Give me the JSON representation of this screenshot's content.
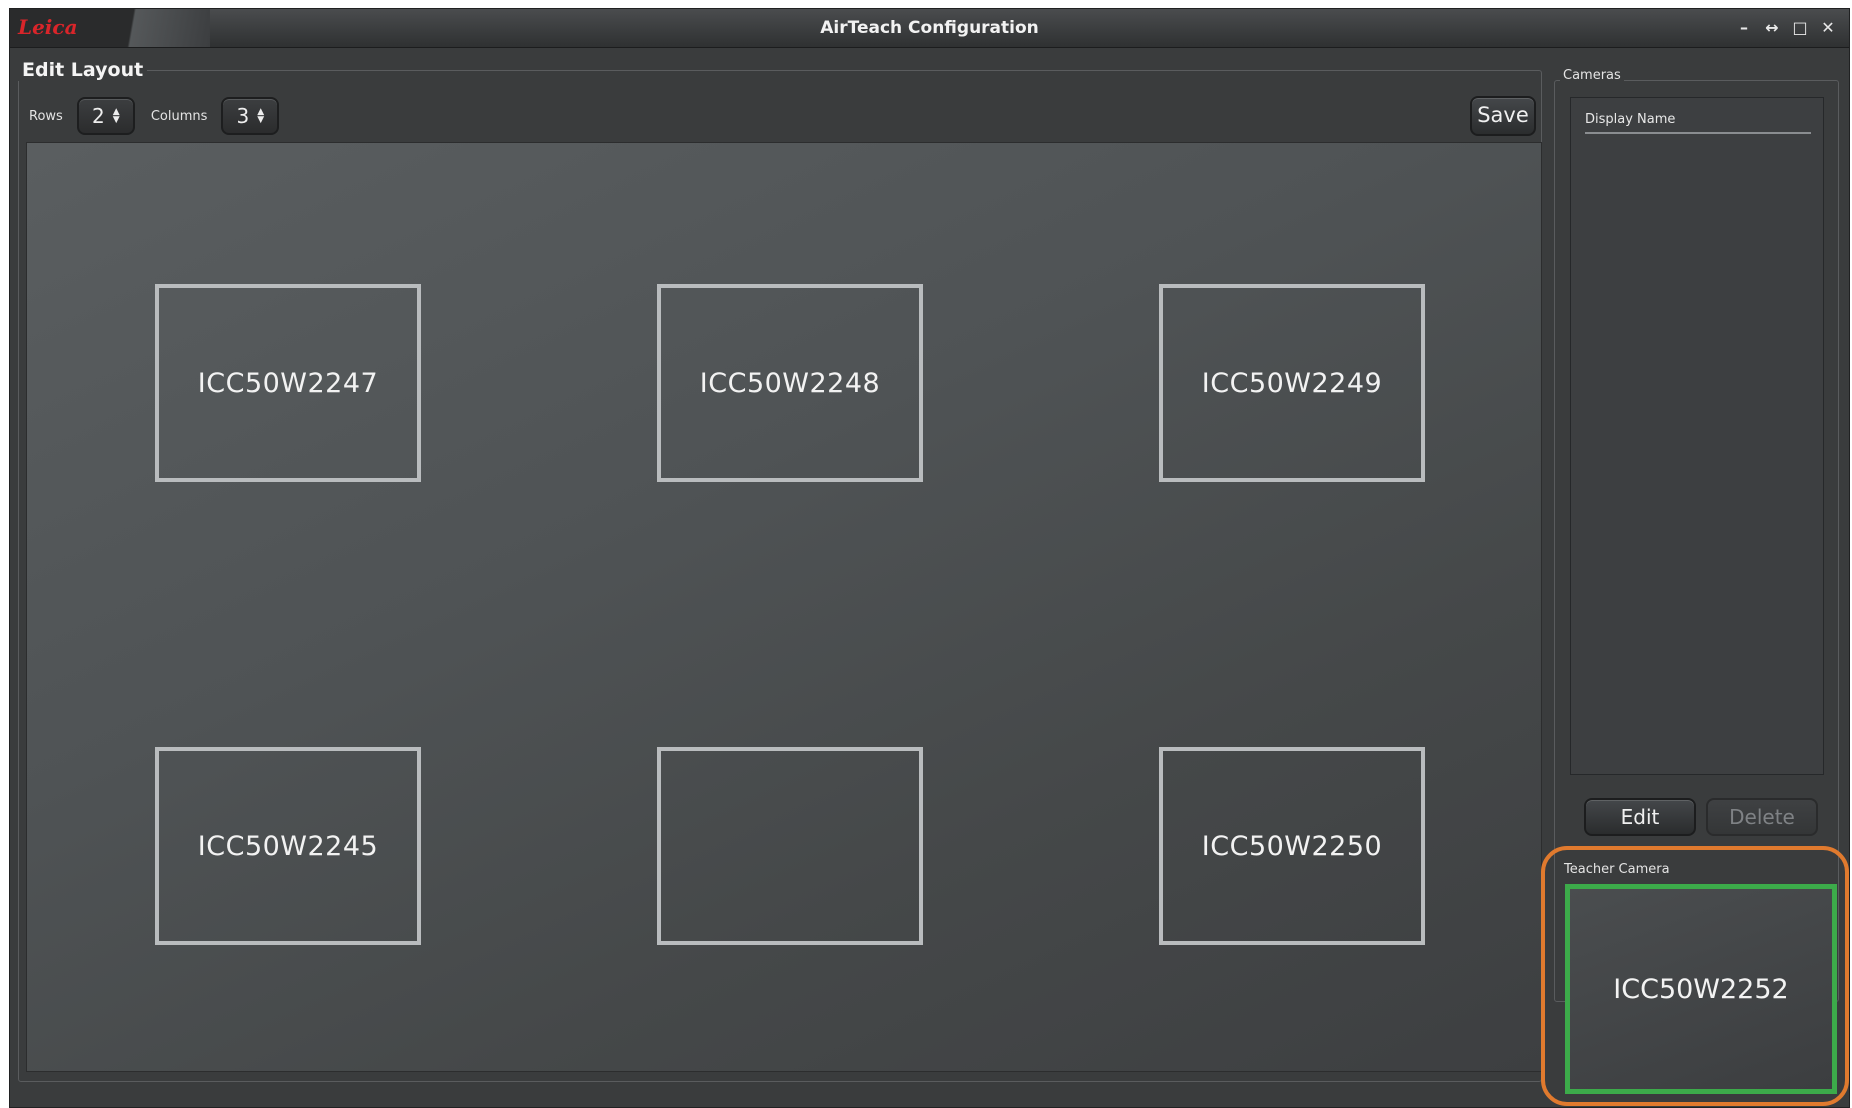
{
  "window": {
    "title": "AirTeach Configuration",
    "logo_text": "Leica",
    "controls": [
      "–",
      "↔",
      "□",
      "✕"
    ]
  },
  "edit_layout": {
    "label": "Edit Layout",
    "rows_label": "Rows",
    "rows_value": "2",
    "columns_label": "Columns",
    "columns_value": "3",
    "save_label": "Save",
    "tiles": [
      "ICC50W2247",
      "ICC50W2248",
      "ICC50W2249",
      "ICC50W2245",
      "",
      "ICC50W2250"
    ]
  },
  "cameras": {
    "label": "Cameras",
    "column_header": "Display Name",
    "edit_label": "Edit",
    "delete_label": "Delete"
  },
  "teacher_camera": {
    "label": "Teacher Camera",
    "name": "ICC50W2252"
  },
  "colors": {
    "teacher_border": "#3cab4a",
    "highlight": "#e07a2e",
    "logo": "#d9252a"
  }
}
